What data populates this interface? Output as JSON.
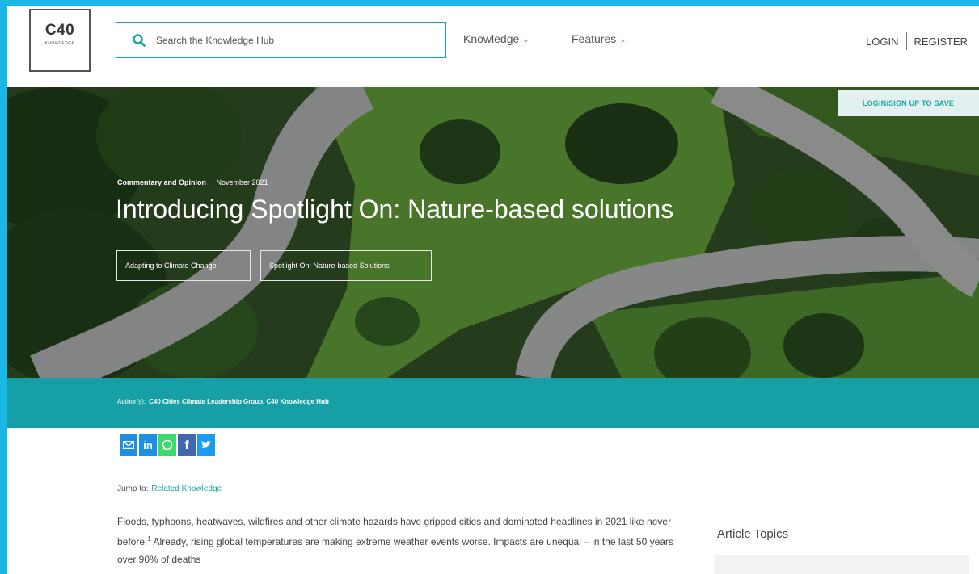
{
  "logo": {
    "main": "C40",
    "sub": "KNOWLEDGE"
  },
  "search": {
    "placeholder": "Search the Knowledge Hub",
    "icon": "search-icon"
  },
  "nav": {
    "items": [
      {
        "label": "Knowledge",
        "icon": "chevron-down-icon"
      },
      {
        "label": "Features",
        "icon": "chevron-down-icon"
      }
    ]
  },
  "auth": {
    "login": "LOGIN",
    "register": "REGISTER"
  },
  "hero": {
    "save_label": "LOGIN/SIGN UP TO SAVE",
    "category": "Commentary and Opinion",
    "date": "November 2021",
    "title": "Introducing Spotlight On: Nature-based solutions",
    "tags": [
      "Adapting to Climate Change",
      "Spotlight On: Nature-based Solutions"
    ]
  },
  "authors": {
    "label": "Author(s):",
    "names": "C40 Cities Climate Leadership Group, C40 Knowledge Hub"
  },
  "share": {
    "icons": [
      "email-icon",
      "linkedin-icon",
      "whatsapp-icon",
      "facebook-icon",
      "twitter-icon"
    ]
  },
  "jump": {
    "label": "Jump to:",
    "link": "Related Knowledge"
  },
  "article": {
    "text_before_ref": "Floods, typhoons, heatwaves, wildfires and other climate hazards have gripped cities and dominated headlines in 2021 like never before.",
    "footnote": "1",
    "text_after_ref": " Already, rising global temperatures are making extreme weather events worse. Impacts are unequal – in the last 50 years over 90% of deaths"
  },
  "sidebar": {
    "topics_heading": "Article Topics"
  },
  "colors": {
    "brand_teal": "#16a0a6",
    "frame_blue": "#1ab7e6"
  }
}
